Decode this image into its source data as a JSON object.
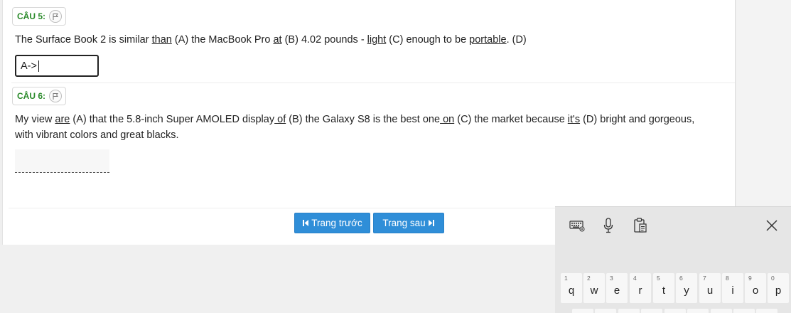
{
  "questions": [
    {
      "label": "CÂU 5:",
      "parts": [
        "The Surface Book 2 is similar ",
        "than",
        " (A) the MacBook Pro ",
        "at",
        " (B) 4.02 pounds - ",
        "light",
        " (C) enough to be ",
        "portable",
        ". (D)"
      ],
      "answer_value": "A->"
    },
    {
      "label": "CÂU 6:",
      "parts": [
        "My view ",
        "are",
        " (A) that the 5.8-inch Super AMOLED display",
        " of",
        " (B) the Galaxy S8 is the best one",
        " on",
        " (C) the market because ",
        "it's",
        " (D) bright and gorgeous,"
      ],
      "line2": "with vibrant colors and great blacks.",
      "answer_value": ""
    }
  ],
  "nav": {
    "prev_label": "Trang trước",
    "next_label": "Trang sau"
  },
  "keyboard": {
    "tools": [
      "keyboard-settings-icon",
      "microphone-icon",
      "clipboard-icon",
      "close-icon"
    ],
    "keys": [
      {
        "num": "1",
        "ch": "q"
      },
      {
        "num": "2",
        "ch": "w"
      },
      {
        "num": "3",
        "ch": "e"
      },
      {
        "num": "4",
        "ch": "r"
      },
      {
        "num": "5",
        "ch": "t"
      },
      {
        "num": "6",
        "ch": "y"
      },
      {
        "num": "7",
        "ch": "u"
      },
      {
        "num": "8",
        "ch": "i"
      },
      {
        "num": "9",
        "ch": "o"
      },
      {
        "num": "0",
        "ch": "p"
      }
    ]
  },
  "colors": {
    "accent": "#2f8ed8",
    "question_label": "#2a8a2a"
  }
}
